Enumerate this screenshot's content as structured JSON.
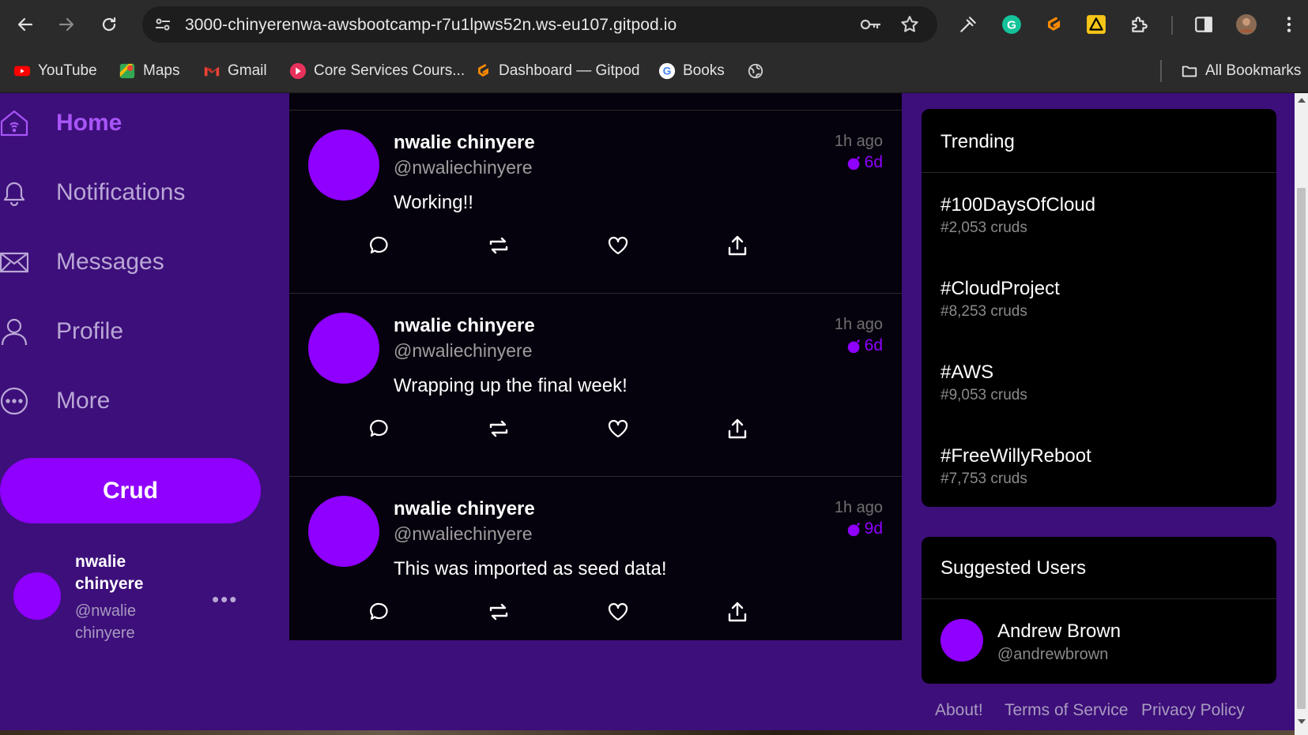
{
  "browser": {
    "url": "3000-chinyerenwa-awsbootcamp-r7u1lpws52n.ws-eu107.gitpod.io",
    "bookmarks": [
      {
        "label": "YouTube",
        "icon": "youtube-icon"
      },
      {
        "label": "Maps",
        "icon": "maps-icon"
      },
      {
        "label": "Gmail",
        "icon": "gmail-icon"
      },
      {
        "label": "Core Services Cours...",
        "icon": "core-services-icon"
      },
      {
        "label": "Dashboard — Gitpod",
        "icon": "gitpod-icon"
      },
      {
        "label": "Books",
        "icon": "google-icon"
      }
    ],
    "all_bookmarks": "All Bookmarks"
  },
  "sidebar": {
    "items": [
      {
        "label": "Home",
        "icon": "home-icon",
        "active": true
      },
      {
        "label": "Notifications",
        "icon": "bell-icon"
      },
      {
        "label": "Messages",
        "icon": "mail-icon"
      },
      {
        "label": "Profile",
        "icon": "person-icon"
      },
      {
        "label": "More",
        "icon": "more-circle-icon"
      }
    ],
    "crud_button": "Crud",
    "profile": {
      "name": "nwalie chinyere",
      "handle": "@nwalie chinyere"
    }
  },
  "feed": {
    "posts": [
      {
        "name": "nwalie chinyere",
        "handle": "@nwaliechinyere",
        "message": "Working!!",
        "ago": "1h ago",
        "expires": "6d"
      },
      {
        "name": "nwalie chinyere",
        "handle": "@nwaliechinyere",
        "message": "Wrapping up the final week!",
        "ago": "1h ago",
        "expires": "6d"
      },
      {
        "name": "nwalie chinyere",
        "handle": "@nwaliechinyere",
        "message": "This was imported as seed data!",
        "ago": "1h ago",
        "expires": "9d"
      }
    ]
  },
  "trending": {
    "title": "Trending",
    "items": [
      {
        "tag": "#100DaysOfCloud",
        "count": "#2,053 cruds"
      },
      {
        "tag": "#CloudProject",
        "count": "#8,253 cruds"
      },
      {
        "tag": "#AWS",
        "count": "#9,053 cruds"
      },
      {
        "tag": "#FreeWillyReboot",
        "count": "#7,753 cruds"
      }
    ]
  },
  "suggested": {
    "title": "Suggested Users",
    "users": [
      {
        "name": "Andrew Brown",
        "handle": "@andrewbrown"
      }
    ]
  },
  "footer": {
    "about": "About!",
    "terms": "Terms of Service",
    "privacy": "Privacy Policy"
  },
  "colors": {
    "accent": "#8f00ff",
    "app_bg": "#3d0f7a",
    "feed_bg": "#06020d",
    "panel_bg": "#000000"
  }
}
